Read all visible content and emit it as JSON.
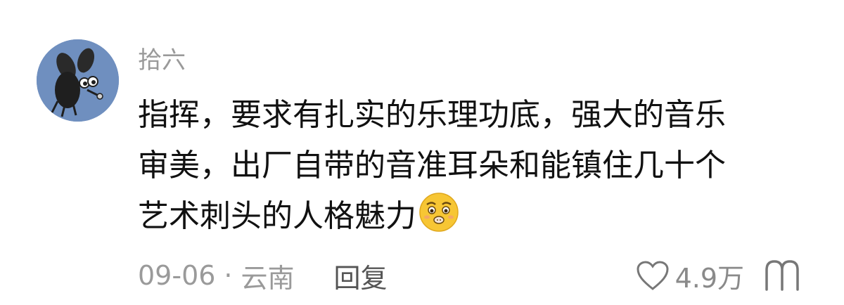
{
  "comment": {
    "username": "拾六",
    "avatar_icon": "cartoon-fly-icon",
    "text_lines": [
      "指挥，要求有扎实的乐理功底，强大的音乐",
      "审美，出厂自带的音准耳朵和能镇住几十个",
      "艺术刺头的人格魅力"
    ],
    "emoji_icon": "pleading-face-emoji",
    "date": "09-06",
    "separator": "·",
    "location": "云南",
    "reply_label": "回复",
    "like_icon": "heart-outline-icon",
    "like_count": "4.9万",
    "more_icon": "dislike-icon"
  },
  "colors": {
    "avatar_bg": "#6f8fbf",
    "text": "#111111",
    "muted": "#9a9a9a"
  }
}
